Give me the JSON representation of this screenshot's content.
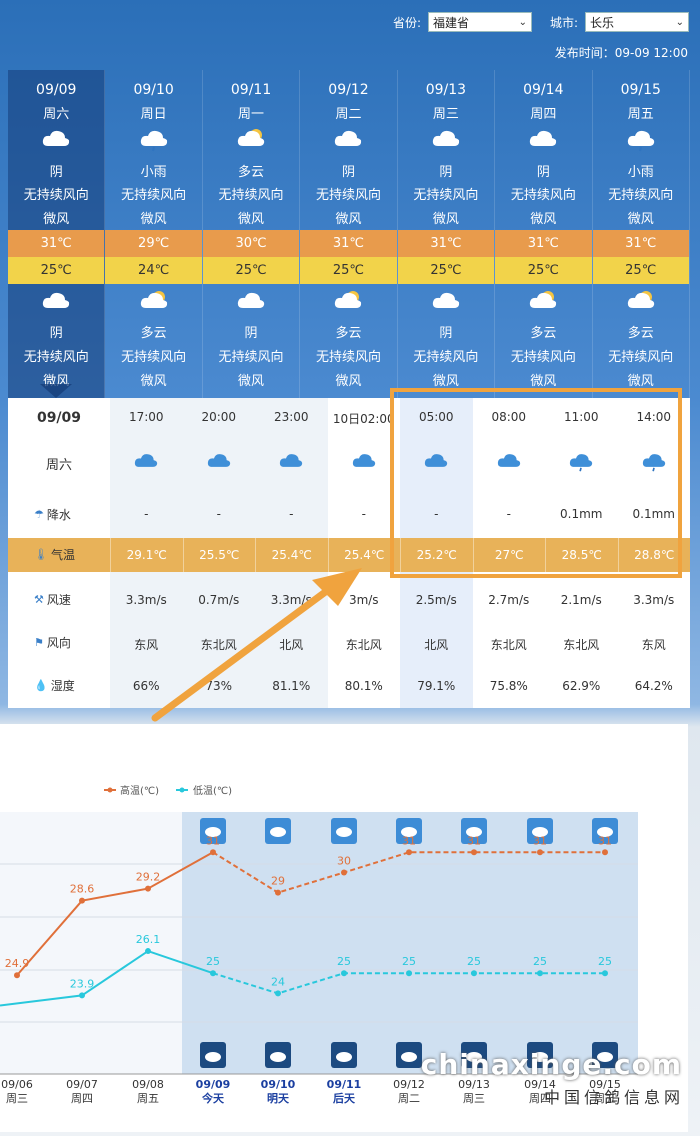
{
  "header": {
    "province_label": "省份:",
    "province_value": "福建省",
    "city_label": "城市:",
    "city_value": "长乐",
    "publish_time": "发布时间：09-09 12:00"
  },
  "days": [
    {
      "date": "09/09",
      "weekday": "周六",
      "day_weather": "阴",
      "day_wind_dir": "无持续风向",
      "day_wind": "微风",
      "high": "31℃",
      "low": "25℃",
      "night_weather": "阴",
      "night_wind_dir": "无持续风向",
      "night_wind": "微风",
      "day_icon": "cloudy-icon",
      "night_icon": "cloudy-icon"
    },
    {
      "date": "09/10",
      "weekday": "周日",
      "day_weather": "小雨",
      "day_wind_dir": "无持续风向",
      "day_wind": "微风",
      "high": "29℃",
      "low": "24℃",
      "night_weather": "多云",
      "night_wind_dir": "无持续风向",
      "night_wind": "微风",
      "day_icon": "light-rain-icon",
      "night_icon": "partly-cloudy-icon"
    },
    {
      "date": "09/11",
      "weekday": "周一",
      "day_weather": "多云",
      "day_wind_dir": "无持续风向",
      "day_wind": "微风",
      "high": "30℃",
      "low": "25℃",
      "night_weather": "阴",
      "night_wind_dir": "无持续风向",
      "night_wind": "微风",
      "day_icon": "partly-cloudy-icon",
      "night_icon": "cloudy-icon"
    },
    {
      "date": "09/12",
      "weekday": "周二",
      "day_weather": "阴",
      "day_wind_dir": "无持续风向",
      "day_wind": "微风",
      "high": "31℃",
      "low": "25℃",
      "night_weather": "多云",
      "night_wind_dir": "无持续风向",
      "night_wind": "微风",
      "day_icon": "cloudy-icon",
      "night_icon": "partly-cloudy-icon"
    },
    {
      "date": "09/13",
      "weekday": "周三",
      "day_weather": "阴",
      "day_wind_dir": "无持续风向",
      "day_wind": "微风",
      "high": "31℃",
      "low": "25℃",
      "night_weather": "阴",
      "night_wind_dir": "无持续风向",
      "night_wind": "微风",
      "day_icon": "cloudy-icon",
      "night_icon": "cloudy-icon"
    },
    {
      "date": "09/14",
      "weekday": "周四",
      "day_weather": "阴",
      "day_wind_dir": "无持续风向",
      "day_wind": "微风",
      "high": "31℃",
      "low": "25℃",
      "night_weather": "多云",
      "night_wind_dir": "无持续风向",
      "night_wind": "微风",
      "day_icon": "cloudy-icon",
      "night_icon": "partly-cloudy-icon"
    },
    {
      "date": "09/15",
      "weekday": "周五",
      "day_weather": "小雨",
      "day_wind_dir": "无持续风向",
      "day_wind": "微风",
      "high": "31℃",
      "low": "25℃",
      "night_weather": "多云",
      "night_wind_dir": "无持续风向",
      "night_wind": "微风",
      "day_icon": "light-rain-icon",
      "night_icon": "partly-cloudy-icon"
    }
  ],
  "hourly": {
    "date": "09/09",
    "weekday": "周六",
    "labels": {
      "precip": "降水",
      "temp": "气温",
      "wind_speed": "风速",
      "wind_dir": "风向",
      "humidity": "湿度"
    },
    "hours": [
      {
        "time": "17:00",
        "precip": "-",
        "temp": "29.1℃",
        "wind_speed": "3.3m/s",
        "wind_dir": "东风",
        "humidity": "66%",
        "icon": "cloudy-icon"
      },
      {
        "time": "20:00",
        "precip": "-",
        "temp": "25.5℃",
        "wind_speed": "0.7m/s",
        "wind_dir": "东北风",
        "humidity": "73%",
        "icon": "cloudy-icon"
      },
      {
        "time": "23:00",
        "precip": "-",
        "temp": "25.4℃",
        "wind_speed": "3.3m/s",
        "wind_dir": "北风",
        "humidity": "81.1%",
        "icon": "cloudy-icon"
      },
      {
        "time": "10日02:00",
        "precip": "-",
        "temp": "25.4℃",
        "wind_speed": "3m/s",
        "wind_dir": "东北风",
        "humidity": "80.1%",
        "icon": "cloudy-icon"
      },
      {
        "time": "05:00",
        "precip": "-",
        "temp": "25.2℃",
        "wind_speed": "2.5m/s",
        "wind_dir": "北风",
        "humidity": "79.1%",
        "icon": "cloudy-icon"
      },
      {
        "time": "08:00",
        "precip": "-",
        "temp": "27℃",
        "wind_speed": "2.7m/s",
        "wind_dir": "东北风",
        "humidity": "75.8%",
        "icon": "cloudy-icon"
      },
      {
        "time": "11:00",
        "precip": "0.1mm",
        "temp": "28.5℃",
        "wind_speed": "2.1m/s",
        "wind_dir": "东北风",
        "humidity": "62.9%",
        "icon": "light-rain-icon"
      },
      {
        "time": "14:00",
        "precip": "0.1mm",
        "temp": "28.8℃",
        "wind_speed": "3.3m/s",
        "wind_dir": "东风",
        "humidity": "64.2%",
        "icon": "light-rain-icon"
      }
    ]
  },
  "chart_data": {
    "type": "line",
    "legend": [
      "高温(℃)",
      "低温(℃)"
    ],
    "x": [
      "09/06",
      "09/07",
      "09/08",
      "09/09",
      "09/10",
      "09/11",
      "09/12",
      "09/13",
      "09/14",
      "09/15"
    ],
    "x_sub": [
      "周三",
      "周四",
      "周五",
      "今天",
      "明天",
      "后天",
      "周二",
      "周三",
      "周四",
      "周五"
    ],
    "series": [
      {
        "name": "高温(℃)",
        "values": [
          24.9,
          28.6,
          29.2,
          31,
          29,
          30,
          31,
          31,
          31,
          31
        ],
        "color": "#e0703a"
      },
      {
        "name": "低温(℃)",
        "values": [
          null,
          23.9,
          26.1,
          25,
          24,
          25,
          25,
          25,
          25,
          25
        ],
        "color": "#28c8dc"
      }
    ],
    "forecast_start_index": 3
  },
  "watermark": {
    "main": "chinaxinge.com",
    "sub": "中国信鸽信息网"
  }
}
